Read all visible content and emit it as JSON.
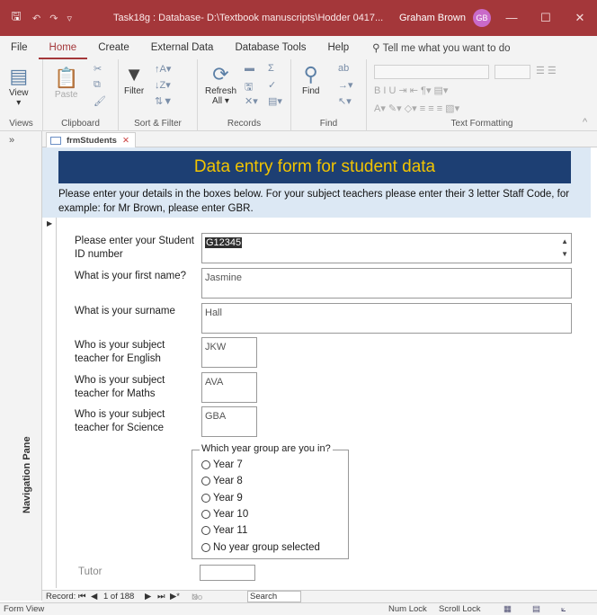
{
  "window": {
    "title": "Task18g : Database- D:\\Textbook manuscripts\\Hodder 0417...",
    "user": "Graham Brown",
    "avatar_initials": "GB",
    "accent": "#a4373a"
  },
  "menu": {
    "tabs": [
      "File",
      "Home",
      "Create",
      "External Data",
      "Database Tools",
      "Help"
    ],
    "active": "Home",
    "tell_me": "Tell me what you want to do"
  },
  "ribbon": {
    "view": "View",
    "views_group": "Views",
    "paste": "Paste",
    "clipboard_group": "Clipboard",
    "filter": "Filter",
    "sort_filter_group": "Sort & Filter",
    "refresh": "Refresh",
    "refresh_all": "All",
    "records_group": "Records",
    "find": "Find",
    "find_group": "Find",
    "text_formatting_group": "Text Formatting"
  },
  "nav_pane": {
    "label": "Navigation Pane",
    "collapse": "»"
  },
  "doc_tab": {
    "label": "frmStudents"
  },
  "form": {
    "heading": "Data entry form for student data",
    "instructions": "Please enter your details in the boxes below. For your subject teachers please enter their 3 letter Staff Code, for example: for Mr Brown, please enter GBR.",
    "student_id_label": "Please enter your Student ID number",
    "student_id_value": "G12345",
    "first_name_label": "What is your first name?",
    "first_name_value": "Jasmine",
    "surname_label": "What is your surname",
    "surname_value": "Hall",
    "english_label": "Who is your subject teacher for English",
    "english_value": "JKW",
    "maths_label": "Who is your subject teacher for Maths",
    "maths_value": "AVA",
    "science_label": "Who is your subject teacher for Science",
    "science_value": "GBA",
    "year_group_label": "Which year group are you in?",
    "year_options": [
      "Year 7",
      "Year 8",
      "Year 9",
      "Year 10",
      "Year 11",
      "No year group selected"
    ],
    "tutor_label": "Tutor",
    "tutor_value": ""
  },
  "record_nav": {
    "label": "Record:",
    "position": "1 of 188",
    "filter": "No Filter",
    "search": "Search"
  },
  "status": {
    "view": "Form View",
    "num_lock": "Num Lock",
    "scroll_lock": "Scroll Lock"
  }
}
